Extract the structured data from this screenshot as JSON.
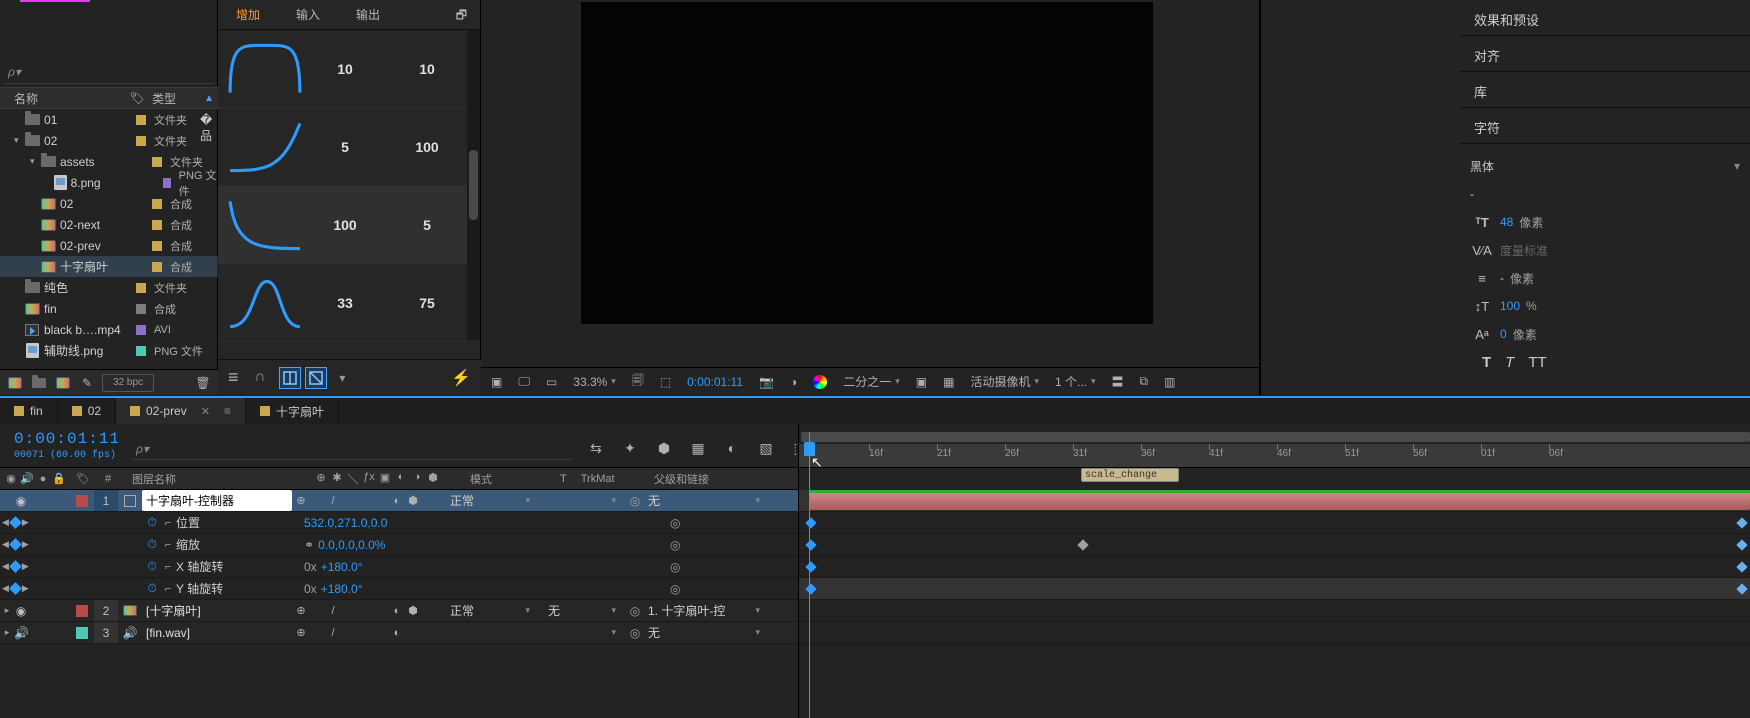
{
  "project": {
    "search_placeholder": "ρ▾",
    "columns": {
      "name": "名称",
      "type": "类型"
    },
    "items": [
      {
        "icon": "folder",
        "name": "01",
        "type": "文件夹",
        "indent": 0,
        "swatch": "#c9a94f",
        "flag": true
      },
      {
        "icon": "folder",
        "name": "02",
        "type": "文件夹",
        "indent": 0,
        "swatch": "#c9a94f",
        "twisty": "open"
      },
      {
        "icon": "folder",
        "name": "assets",
        "type": "文件夹",
        "indent": 1,
        "swatch": "#c9a94f",
        "twisty": "open"
      },
      {
        "icon": "png",
        "name": "8.png",
        "type": "PNG 文件",
        "indent": 3,
        "swatch": "#906fc9"
      },
      {
        "icon": "comp",
        "name": "02",
        "type": "合成",
        "indent": 1,
        "swatch": "#c9a94f"
      },
      {
        "icon": "comp",
        "name": "02-next",
        "type": "合成",
        "indent": 1,
        "swatch": "#c9a94f"
      },
      {
        "icon": "comp",
        "name": "02-prev",
        "type": "合成",
        "indent": 1,
        "swatch": "#c9a94f"
      },
      {
        "icon": "comp",
        "name": "十字扇叶",
        "type": "合成",
        "indent": 1,
        "swatch": "#c9a94f",
        "selected": true
      },
      {
        "icon": "folder",
        "name": "纯色",
        "type": "文件夹",
        "indent": 0,
        "swatch": "#c9a94f"
      },
      {
        "icon": "comp",
        "name": "fin",
        "type": "合成",
        "indent": 0,
        "swatch": "#7d7d7d"
      },
      {
        "icon": "avi",
        "name": "black b….mp4",
        "type": "AVI",
        "indent": 0,
        "swatch": "#906fc9"
      },
      {
        "icon": "png",
        "name": "辅助线.png",
        "type": "PNG 文件",
        "indent": 0,
        "swatch": "#4fc9b5"
      }
    ],
    "bpc": "32 bpc"
  },
  "ease": {
    "tabs": {
      "add": "增加",
      "in": "输入",
      "out": "输出",
      "link": "🗗"
    },
    "rows": [
      {
        "in": "10",
        "out": "10",
        "curve": "bell"
      },
      {
        "in": "5",
        "out": "100",
        "curve": "easein"
      },
      {
        "in": "100",
        "out": "5",
        "curve": "easeout",
        "highlight": true
      },
      {
        "in": "33",
        "out": "75",
        "curve": "bump"
      }
    ]
  },
  "viewer": {
    "zoom": "33.3%",
    "timecode": "0:00:01:11",
    "quality": "二分之一",
    "camera": "活动摄像机",
    "views": "1 个..."
  },
  "right": {
    "panels": [
      "效果和预设",
      "对齐",
      "库",
      "字符"
    ],
    "font": "黑体",
    "style": "-",
    "size": "48",
    "size_unit": "像素",
    "kern": "度量标准",
    "leading": "-",
    "leading_unit": "像素",
    "vscale": "100",
    "vscale_unit": "%",
    "baseline": "0",
    "baseline_unit": "像素"
  },
  "comp_tabs": [
    {
      "label": "fin"
    },
    {
      "label": "02"
    },
    {
      "label": "02-prev",
      "active": true
    },
    {
      "label": "十字扇叶"
    }
  ],
  "timeline": {
    "timecode": "0:00:01:11",
    "frames": "00071 (60.00 fps)",
    "search_placeholder": "ρ▾",
    "headers": {
      "layer_name": "图层名称",
      "mode": "模式",
      "trkmat": "TrkMat",
      "parent": "父级和链接"
    },
    "ruler_ticks": [
      "16f",
      "21f",
      "26f",
      "31f",
      "36f",
      "41f",
      "46f",
      "51f",
      "56f",
      "01f",
      "06f"
    ],
    "marker": "scale_change",
    "layers": [
      {
        "num": "1",
        "icon": "null",
        "name": "十字扇叶-控制器",
        "mode": "正常",
        "trkmat": "",
        "parent": "无",
        "swatch": "#b84a4a",
        "selected": true,
        "props": [
          {
            "name": "位置",
            "value": "532.0,271.0,0.0"
          },
          {
            "name": "缩放",
            "value": "0.0,0.0,0.0%",
            "linked": true
          },
          {
            "name": "X 轴旋转",
            "value_prefix": "0x",
            "value": "+180.0°"
          },
          {
            "name": "Y 轴旋转",
            "value_prefix": "0x",
            "value": "+180.0°",
            "sel": true
          }
        ]
      },
      {
        "num": "2",
        "icon": "comp",
        "name": "[十字扇叶]",
        "mode": "正常",
        "trkmat": "无",
        "parent": "1. 十字扇叶-控",
        "swatch": "#b84a4a"
      },
      {
        "num": "3",
        "icon": "audio",
        "name": "[fin.wav]",
        "mode": "",
        "trkmat": "",
        "parent": "无",
        "swatch": "#4fc9b5"
      }
    ],
    "t_char": "T"
  }
}
